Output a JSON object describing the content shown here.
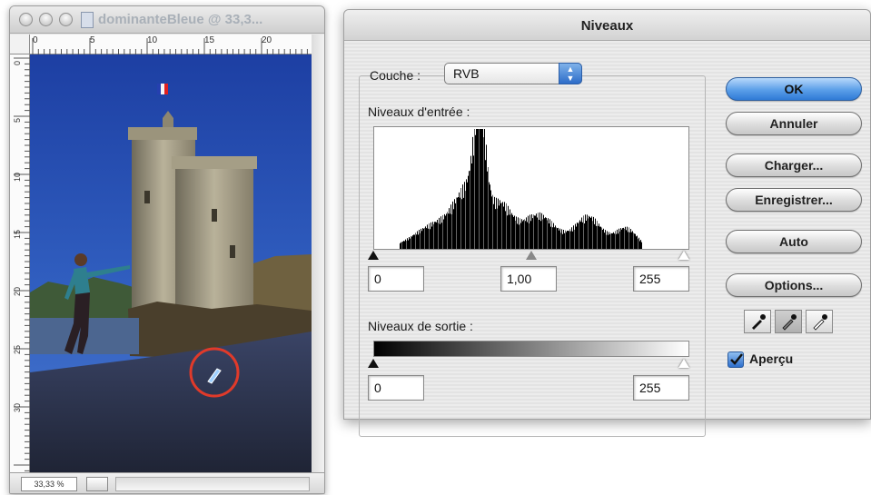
{
  "document_window": {
    "title": "dominanteBleue @ 33,3...",
    "ruler_h_ticks": [
      "0",
      "5",
      "10",
      "15",
      "20"
    ],
    "ruler_v_ticks": [
      "0",
      "5",
      "10",
      "15",
      "20",
      "25",
      "30"
    ],
    "zoom": "33,33 %"
  },
  "levels_dialog": {
    "title": "Niveaux",
    "channel_label": "Couche :",
    "channel_value": "RVB",
    "input_label": "Niveaux d'entrée :",
    "input_black": "0",
    "input_gamma": "1,00",
    "input_white": "255",
    "output_label": "Niveaux de sortie :",
    "output_black": "0",
    "output_white": "255",
    "buttons": {
      "ok": "OK",
      "cancel": "Annuler",
      "load": "Charger...",
      "save": "Enregistrer...",
      "auto": "Auto",
      "options": "Options..."
    },
    "preview_label": "Aperçu",
    "preview_checked": true,
    "eyedroppers": [
      "black-point-eyedropper-icon",
      "gray-point-eyedropper-icon",
      "white-point-eyedropper-icon"
    ],
    "active_eyedropper": "gray-point-eyedropper-icon",
    "accent_color": "#3a82dc"
  }
}
